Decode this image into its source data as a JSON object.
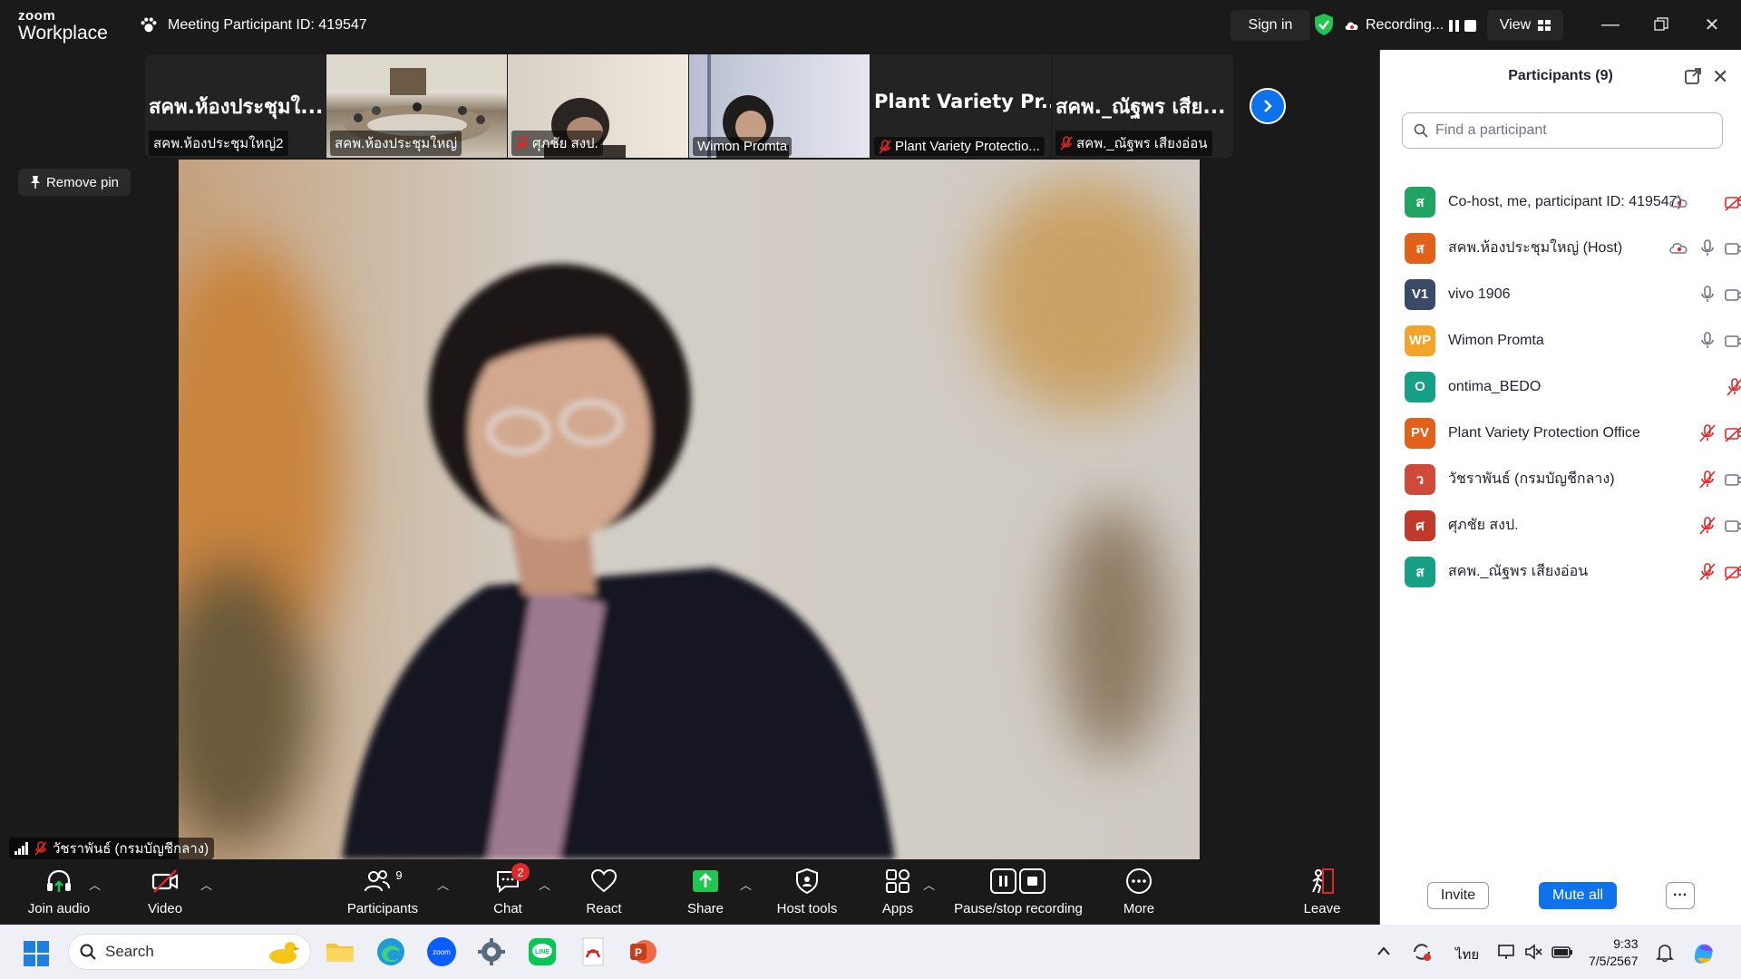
{
  "app": {
    "logo_line1": "zoom",
    "logo_line2": "Workplace",
    "meeting_title": "Meeting Participant ID: 419547",
    "sign_in": "Sign in",
    "recording": "Recording...",
    "view": "View"
  },
  "strip": {
    "tiles": [
      {
        "big": "สคพ.ห้องประชุมใ...",
        "name": "สคพ.ห้องประชุมใหญ่2",
        "muted": false,
        "type": "text"
      },
      {
        "big": "",
        "name": "สคพ.ห้องประชุมใหญ่",
        "muted": false,
        "type": "room"
      },
      {
        "big": "",
        "name": "ศุภชัย สงป.",
        "muted": true,
        "type": "person"
      },
      {
        "big": "",
        "name": "Wimon Promta",
        "muted": false,
        "type": "person2"
      },
      {
        "big": "Plant Variety Pr...",
        "name": "Plant Variety Protectio...",
        "muted": true,
        "type": "text"
      },
      {
        "big": "สคพ._ณัฐพร เสีย...",
        "name": "สคพ._ณัฐพร เสียงอ่อน",
        "muted": true,
        "type": "text"
      }
    ]
  },
  "stage": {
    "remove_pin": "Remove pin",
    "speaker_name": "วัชราพันธ์ (กรมบัญชีกลาง)"
  },
  "toolbar": {
    "join_audio": "Join audio",
    "video": "Video",
    "participants": "Participants",
    "participants_count": "9",
    "chat": "Chat",
    "chat_badge": "2",
    "react": "React",
    "share": "Share",
    "host_tools": "Host tools",
    "apps": "Apps",
    "pause_stop": "Pause/stop recording",
    "more": "More",
    "leave": "Leave"
  },
  "panel": {
    "title": "Participants (9)",
    "search_placeholder": "Find a participant",
    "participants": [
      {
        "initials": "ส",
        "color": "#1fa463",
        "name": "Co-host, me, participant ID: 419547)",
        "rec": true,
        "mic": "none",
        "video": "off"
      },
      {
        "initials": "ส",
        "color": "#e1601a",
        "name": "สคพ.ห้องประชุมใหญ่ (Host)",
        "rec": true,
        "mic": "on",
        "video": "on"
      },
      {
        "initials": "V1",
        "color": "#3a4a66",
        "name": "vivo 1906",
        "rec": false,
        "mic": "on",
        "video": "on"
      },
      {
        "initials": "WP",
        "color": "#f3a52a",
        "name": "Wimon Promta",
        "rec": false,
        "mic": "on",
        "video": "on"
      },
      {
        "initials": "O",
        "color": "#16a085",
        "name": "ontima_BEDO",
        "rec": false,
        "mic": "none",
        "video": "mic-off-only"
      },
      {
        "initials": "PV",
        "color": "#e1601a",
        "name": "Plant Variety Protection Office",
        "rec": false,
        "mic": "off",
        "video": "off"
      },
      {
        "initials": "ว",
        "color": "#d04a3a",
        "name": "วัชราพันธ์ (กรมบัญชีกลาง)",
        "rec": false,
        "mic": "off",
        "video": "on"
      },
      {
        "initials": "ศ",
        "color": "#c0392b",
        "name": "ศุภชัย สงป.",
        "rec": false,
        "mic": "off",
        "video": "on"
      },
      {
        "initials": "ส",
        "color": "#16a085",
        "name": "สคพ._ณัฐพร เสียงอ่อน",
        "rec": false,
        "mic": "off",
        "video": "off"
      }
    ],
    "invite": "Invite",
    "mute_all": "Mute all",
    "more": "···"
  },
  "taskbar": {
    "search": "Search",
    "lang": "ไทย",
    "time": "9:33",
    "date": "7/5/2567"
  }
}
